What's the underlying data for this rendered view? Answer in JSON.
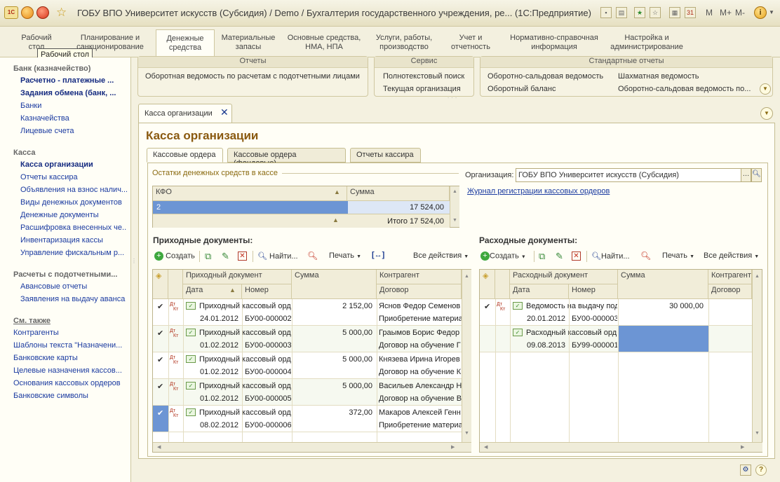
{
  "window": {
    "title": "ГОБУ ВПО Университет искусств (Субсидия) / Demo / Бухгалтерия государственного учреждения, ре...  (1С:Предприятие)",
    "logo": "1С",
    "m_buttons": [
      "M",
      "M+",
      "M-"
    ]
  },
  "sections": [
    {
      "label": "Рабочий стол"
    },
    {
      "label": "Планирование и санкционирование"
    },
    {
      "label": "Денежные средства"
    },
    {
      "label": "Материальные запасы"
    },
    {
      "label": "Основные средства, НМА, НПА"
    },
    {
      "label": "Услуги, работы, производство"
    },
    {
      "label": "Учет и отчетность"
    },
    {
      "label": "Нормативно-справочная информация"
    },
    {
      "label": "Настройка и администрирование"
    }
  ],
  "tooltip": "Рабочий стол",
  "nav": {
    "groups": [
      {
        "title": "Банк (казначейство)",
        "items": [
          {
            "label": "Расчетно - платежные ...",
            "bold": true
          },
          {
            "label": "Задания обмена (банк, ...",
            "bold": true
          },
          {
            "label": "Банки"
          },
          {
            "label": "Казначейства"
          },
          {
            "label": "Лицевые счета"
          }
        ]
      },
      {
        "title": "Касса",
        "items": [
          {
            "label": "Касса организации",
            "bold": true
          },
          {
            "label": "Отчеты кассира"
          },
          {
            "label": "Объявления на взнос налич..."
          },
          {
            "label": "Виды денежных документов"
          },
          {
            "label": "Денежные документы"
          },
          {
            "label": "Расшифровка внесенных че..."
          },
          {
            "label": "Инвентаризация кассы"
          },
          {
            "label": "Управление фискальным р..."
          }
        ]
      },
      {
        "title": "Расчеты с подотчетными...",
        "items": [
          {
            "label": "Авансовые отчеты"
          },
          {
            "label": "Заявления на выдачу аванса"
          }
        ]
      },
      {
        "title": "См. также",
        "items": [
          {
            "label": "Контрагенты"
          },
          {
            "label": "Шаблоны текста \"Назначени..."
          },
          {
            "label": "Банковские карты"
          },
          {
            "label": "Целевые назначения кассов..."
          },
          {
            "label": "Основания кассовых ордеров"
          },
          {
            "label": "Банковские символы"
          }
        ]
      }
    ]
  },
  "commands": {
    "reports": {
      "title": "Отчеты",
      "items": [
        "Оборотная ведомость по расчетам с подотчетными лицами"
      ]
    },
    "service": {
      "title": "Сервис",
      "items": [
        "Полнотекстовый поиск",
        "Текущая организация"
      ]
    },
    "standard": {
      "title": "Стандартные отчеты",
      "items": [
        "Оборотно-сальдовая ведомость",
        "Оборотный баланс",
        "Шахматная ведомость",
        "Оборотно-сальдовая ведомость по..."
      ]
    }
  },
  "tab": {
    "label": "Касса организации"
  },
  "form": {
    "title": "Касса организации",
    "tabs": [
      "Кассовые ордера",
      "Кассовые ордера (фондовые)",
      "Отчеты кассира"
    ],
    "balances": {
      "legend": "Остатки денежных средств в кассе",
      "headers": [
        "КФО",
        "Сумма"
      ],
      "rows": [
        {
          "kfo": "2",
          "sum": "17 524,00"
        }
      ],
      "total": "Итого 17 524,00"
    },
    "org_label": "Организация:",
    "org_value": "ГОБУ ВПО Университет искусств (Субсидия)",
    "journal_link": "Журнал регистрации кассовых ордеров",
    "income": {
      "title": "Приходные документы:",
      "toolbar": {
        "create": "Создать",
        "find": "Найти...",
        "print": "Печать",
        "all": "Все действия"
      },
      "headers": {
        "doc": "Приходный документ",
        "date": "Дата",
        "number": "Номер",
        "sum": "Сумма",
        "contractor": "Контрагент",
        "contract": "Договор"
      },
      "rows": [
        {
          "doc": "Приходный кассовый орд",
          "date": "24.01.2012",
          "number": "БУ00-000002",
          "sum": "2 152,00",
          "contractor": "Яснов Федор Семенов",
          "contract": "Приобретение материа"
        },
        {
          "doc": "Приходный кассовый орд",
          "date": "01.02.2012",
          "number": "БУ00-000003",
          "sum": "5 000,00",
          "contractor": "Граымов Борис Федор",
          "contract": "Договор на обучение Г"
        },
        {
          "doc": "Приходный кассовый орд",
          "date": "01.02.2012",
          "number": "БУ00-000004",
          "sum": "5 000,00",
          "contractor": "Князева Ирина Игорев",
          "contract": "Договор на обучение К"
        },
        {
          "doc": "Приходный кассовый орд",
          "date": "01.02.2012",
          "number": "БУ00-000005",
          "sum": "5 000,00",
          "contractor": "Васильев Александр Н",
          "contract": "Договор на обучение В"
        },
        {
          "doc": "Приходный кассовый орд",
          "date": "08.02.2012",
          "number": "БУ00-000006",
          "sum": "372,00",
          "contractor": "Макаров Алексей Генн",
          "contract": "Приобретение материа"
        }
      ]
    },
    "expense": {
      "title": "Расходные документы:",
      "toolbar": {
        "create": "Создать",
        "find": "Найти...",
        "print": "Печать",
        "all": "Все действия"
      },
      "headers": {
        "doc": "Расходный документ",
        "date": "Дата",
        "number": "Номер",
        "sum": "Сумма",
        "contractor": "Контрагент",
        "contract": "Договор"
      },
      "rows": [
        {
          "doc": "Ведомость на выдачу под",
          "date": "20.01.2012",
          "number": "БУ00-000003",
          "sum": "30 000,00"
        },
        {
          "doc": "Расходный кассовый орд",
          "date": "09.08.2013",
          "number": "БУ99-000001",
          "sum": ""
        }
      ]
    },
    "dt_kt": "Дт Кт"
  }
}
